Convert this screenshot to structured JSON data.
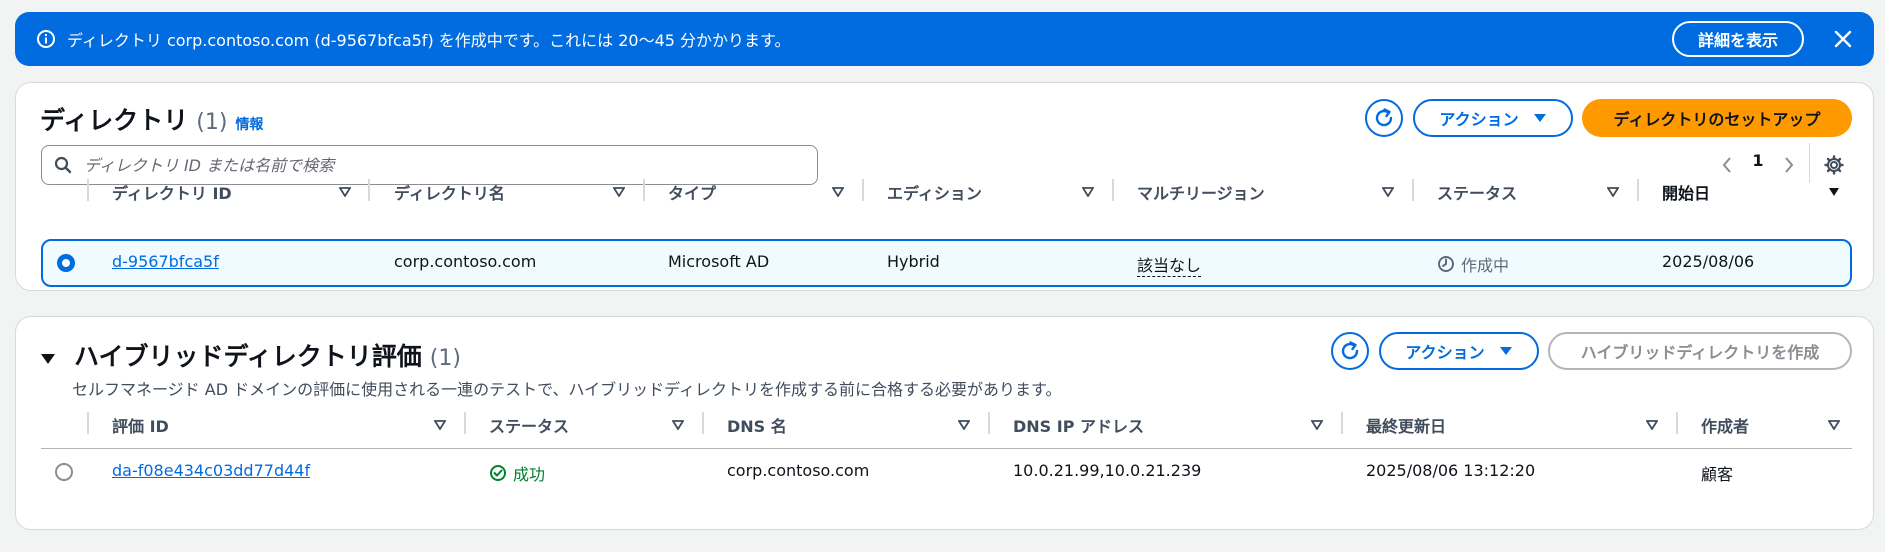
{
  "flash": {
    "message": "ディレクトリ corp.contoso.com (d-9567bfca5f) を作成中です。これには 20〜45 分かかります。",
    "details_label": "詳細を表示"
  },
  "directories": {
    "title": "ディレクトリ",
    "count": "(1)",
    "info_label": "情報",
    "actions_label": "アクション",
    "setup_label": "ディレクトリのセットアップ",
    "search_placeholder": "ディレクトリ ID または名前で検索",
    "page": "1",
    "columns": [
      "ディレクトリ ID",
      "ディレクトリ名",
      "タイプ",
      "エディション",
      "マルチリージョン",
      "ステータス",
      "開始日"
    ],
    "rows": [
      {
        "id": "d-9567bfca5f",
        "name": "corp.contoso.com",
        "type": "Microsoft AD",
        "edition": "Hybrid",
        "multiregion": "該当なし",
        "status": "作成中",
        "start_date": "2025/08/06"
      }
    ]
  },
  "hybrid": {
    "title": "ハイブリッドディレクトリ評価",
    "count": "(1)",
    "description": "セルフマネージド AD ドメインの評価に使用される一連のテストで、ハイブリッドディレクトリを作成する前に合格する必要があります。",
    "actions_label": "アクション",
    "create_label": "ハイブリッドディレクトリを作成",
    "columns": [
      "評価 ID",
      "ステータス",
      "DNS 名",
      "DNS IP アドレス",
      "最終更新日",
      "作成者"
    ],
    "rows": [
      {
        "id": "da-f08e434c03dd77d44f",
        "status": "成功",
        "dns_name": "corp.contoso.com",
        "dns_ip": "10.0.21.99,10.0.21.239",
        "updated": "2025/08/06 13:12:20",
        "creator": "顧客"
      }
    ]
  },
  "colors": {
    "accent": "#006ce0",
    "primary_button": "#ff9900",
    "success": "#00802f",
    "pending": "#5f6b7a"
  }
}
